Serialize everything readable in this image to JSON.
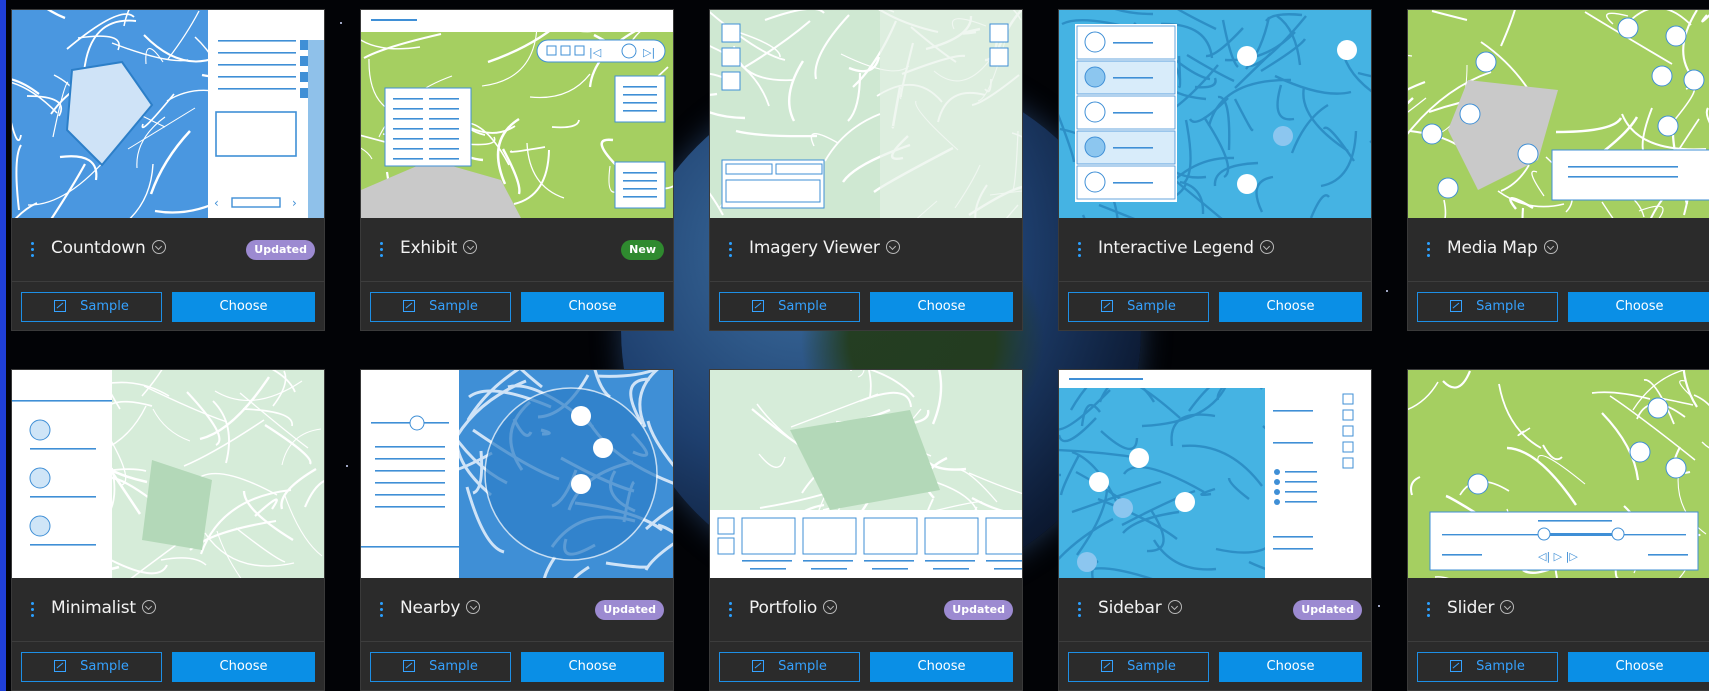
{
  "colors": {
    "accent": "#0a8fe6",
    "badge_updated": "#9c8ad1",
    "badge_new": "#2f8a2f",
    "card_bg": "#2b2b2b"
  },
  "cards": [
    {
      "title": "Countdown",
      "badge": "Updated",
      "badge_type": "updated",
      "sample_label": "Sample",
      "choose_label": "Choose",
      "thumb": "countdown"
    },
    {
      "title": "Exhibit",
      "badge": "New",
      "badge_type": "new",
      "sample_label": "Sample",
      "choose_label": "Choose",
      "thumb": "exhibit"
    },
    {
      "title": "Imagery Viewer",
      "badge": "",
      "badge_type": "",
      "sample_label": "Sample",
      "choose_label": "Choose",
      "thumb": "imagery"
    },
    {
      "title": "Interactive Legend",
      "badge": "",
      "badge_type": "",
      "sample_label": "Sample",
      "choose_label": "Choose",
      "thumb": "legend"
    },
    {
      "title": "Media Map",
      "badge": "",
      "badge_type": "",
      "sample_label": "Sample",
      "choose_label": "Choose",
      "thumb": "media"
    },
    {
      "title": "Minimalist",
      "badge": "",
      "badge_type": "",
      "sample_label": "Sample",
      "choose_label": "Choose",
      "thumb": "minimalist"
    },
    {
      "title": "Nearby",
      "badge": "Updated",
      "badge_type": "updated",
      "sample_label": "Sample",
      "choose_label": "Choose",
      "thumb": "nearby"
    },
    {
      "title": "Portfolio",
      "badge": "Updated",
      "badge_type": "updated",
      "sample_label": "Sample",
      "choose_label": "Choose",
      "thumb": "portfolio"
    },
    {
      "title": "Sidebar",
      "badge": "Updated",
      "badge_type": "updated",
      "sample_label": "Sample",
      "choose_label": "Choose",
      "thumb": "sidebar"
    },
    {
      "title": "Slider",
      "badge": "",
      "badge_type": "",
      "sample_label": "Sample",
      "choose_label": "Choose",
      "thumb": "slider"
    }
  ]
}
